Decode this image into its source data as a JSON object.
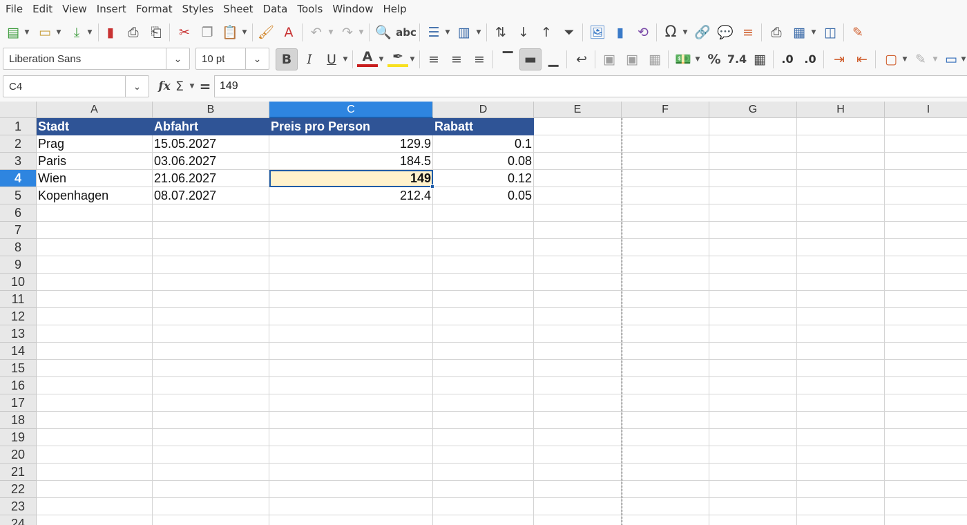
{
  "menu": [
    "File",
    "Edit",
    "View",
    "Insert",
    "Format",
    "Styles",
    "Sheet",
    "Data",
    "Tools",
    "Window",
    "Help"
  ],
  "toolbar": {
    "font_name": "Liberation Sans",
    "font_size": "10 pt",
    "number_format_decimal_label": "7.4",
    "percent_label": "%"
  },
  "namebox": {
    "value": "C4"
  },
  "formula": {
    "content": "149",
    "eq_symbol": "="
  },
  "columns": [
    "A",
    "B",
    "C",
    "D",
    "E",
    "F",
    "G",
    "H",
    "I"
  ],
  "selected_column": "C",
  "rows": [
    "1",
    "2",
    "3",
    "4",
    "5",
    "6",
    "7",
    "8",
    "9",
    "10",
    "11",
    "12",
    "13",
    "14",
    "15",
    "16",
    "17",
    "18",
    "19",
    "20",
    "21",
    "22",
    "23",
    "24"
  ],
  "selected_row": "4",
  "sheet": {
    "header": [
      "Stadt",
      "Abfahrt",
      "Preis pro Person",
      "Rabatt"
    ],
    "data": [
      [
        "Prag",
        "15.05.2027",
        "129.9",
        "0.1"
      ],
      [
        "Paris",
        "03.06.2027",
        "184.5",
        "0.08"
      ],
      [
        "Wien",
        "21.06.2027",
        "149",
        "0.12"
      ],
      [
        "Kopenhagen",
        "08.07.2027",
        "212.4",
        "0.05"
      ]
    ]
  },
  "colors": {
    "header_fill": "#2f5496",
    "active_fill": "#fff2cc",
    "selection": "#2e85e0"
  }
}
